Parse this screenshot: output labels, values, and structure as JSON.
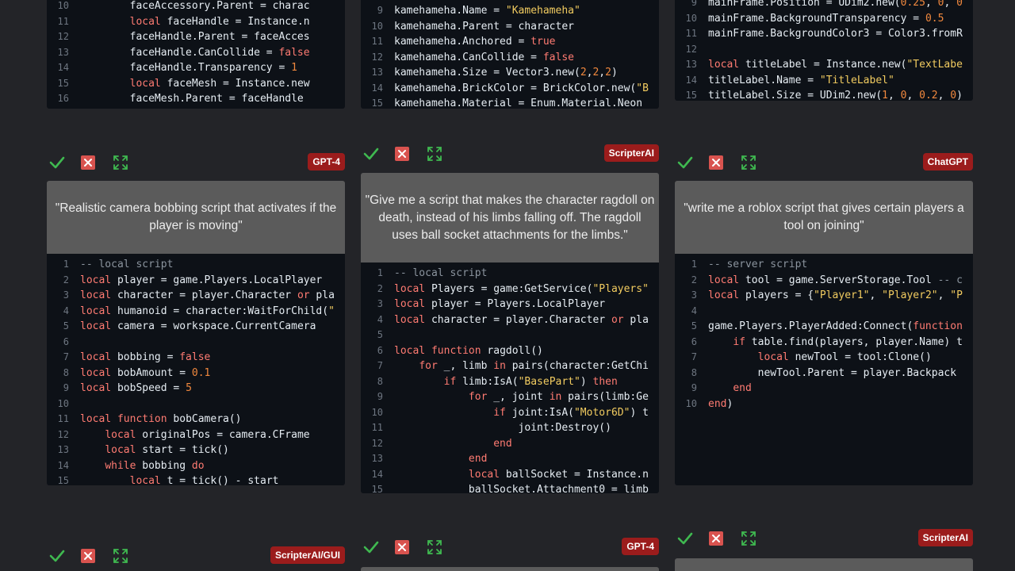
{
  "colors": {
    "background": "#232428",
    "check": "#3fb950",
    "reject": "#d9534f",
    "expand": "#3fb950",
    "badge": "#9b1c1c",
    "prompt_bg": "#5b5b5b",
    "code_bg": "#0d1117"
  },
  "icons": [
    "check-icon",
    "reject-x-icon",
    "expand-icon"
  ],
  "top_row": [
    {
      "lines": [
        {
          "n": "10",
          "t": "        faceAccessory.Parent = charac"
        },
        {
          "n": "11",
          "t": "        local faceHandle = Instance.n"
        },
        {
          "n": "12",
          "t": "        faceHandle.Parent = faceAcces"
        },
        {
          "n": "13",
          "t": "        faceHandle.CanCollide = false"
        },
        {
          "n": "14",
          "t": "        faceHandle.Transparency = 1"
        },
        {
          "n": "15",
          "t": "        local faceMesh = Instance.new"
        },
        {
          "n": "16",
          "t": "        faceMesh.Parent = faceHandle"
        }
      ]
    },
    {
      "lines": [
        {
          "n": "9",
          "t": "kamehameha.Name = \"Kamehameha\""
        },
        {
          "n": "10",
          "t": "kamehameha.Parent = character"
        },
        {
          "n": "11",
          "t": "kamehameha.Anchored = true"
        },
        {
          "n": "12",
          "t": "kamehameha.CanCollide = false"
        },
        {
          "n": "13",
          "t": "kamehameha.Size = Vector3.new(2,2,2)"
        },
        {
          "n": "14",
          "t": "kamehameha.BrickColor = BrickColor.new(\"B"
        },
        {
          "n": "15",
          "t": "kamehameha.Material = Enum.Material.Neon"
        }
      ]
    },
    {
      "lines": [
        {
          "n": "9",
          "t": "mainFrame.Position = UDim2.new(0.25, 0, 0"
        },
        {
          "n": "10",
          "t": "mainFrame.BackgroundTransparency = 0.5"
        },
        {
          "n": "11",
          "t": "mainFrame.BackgroundColor3 = Color3.fromR"
        },
        {
          "n": "12",
          "t": ""
        },
        {
          "n": "13",
          "t": "local titleLabel = Instance.new(\"TextLabe"
        },
        {
          "n": "14",
          "t": "titleLabel.Name = \"TitleLabel\""
        },
        {
          "n": "15",
          "t": "titleLabel.Size = UDim2.new(1, 0, 0.2, 0)"
        }
      ]
    }
  ],
  "middle_row": [
    {
      "badge": "GPT-4",
      "prompt": "\"Realistic camera bobbing script that activates if the player is moving\"",
      "lines": [
        {
          "n": "1",
          "t": "-- local script"
        },
        {
          "n": "2",
          "t": "local player = game.Players.LocalPlayer"
        },
        {
          "n": "3",
          "t": "local character = player.Character or pla"
        },
        {
          "n": "4",
          "t": "local humanoid = character:WaitForChild(\""
        },
        {
          "n": "5",
          "t": "local camera = workspace.CurrentCamera"
        },
        {
          "n": "6",
          "t": ""
        },
        {
          "n": "7",
          "t": "local bobbing = false"
        },
        {
          "n": "8",
          "t": "local bobAmount = 0.1"
        },
        {
          "n": "9",
          "t": "local bobSpeed = 5"
        },
        {
          "n": "10",
          "t": ""
        },
        {
          "n": "11",
          "t": "local function bobCamera()"
        },
        {
          "n": "12",
          "t": "    local originalPos = camera.CFrame"
        },
        {
          "n": "13",
          "t": "    local start = tick()"
        },
        {
          "n": "14",
          "t": "    while bobbing do"
        },
        {
          "n": "15",
          "t": "        local t = tick() - start"
        }
      ]
    },
    {
      "badge": "ScripterAI",
      "prompt": "\"Give me a script that makes the character ragdoll on death, instead of his limbs falling off. The ragdoll uses ball socket attachments for the limbs.\"",
      "lines": [
        {
          "n": "1",
          "t": "-- local script"
        },
        {
          "n": "2",
          "t": "local Players = game:GetService(\"Players\""
        },
        {
          "n": "3",
          "t": "local player = Players.LocalPlayer"
        },
        {
          "n": "4",
          "t": "local character = player.Character or pla"
        },
        {
          "n": "5",
          "t": ""
        },
        {
          "n": "6",
          "t": "local function ragdoll()"
        },
        {
          "n": "7",
          "t": "    for _, limb in pairs(character:GetChi"
        },
        {
          "n": "8",
          "t": "        if limb:IsA(\"BasePart\") then"
        },
        {
          "n": "9",
          "t": "            for _, joint in pairs(limb:Ge"
        },
        {
          "n": "10",
          "t": "                if joint:IsA(\"Motor6D\") t"
        },
        {
          "n": "11",
          "t": "                    joint:Destroy()"
        },
        {
          "n": "12",
          "t": "                end"
        },
        {
          "n": "13",
          "t": "            end"
        },
        {
          "n": "14",
          "t": "            local ballSocket = Instance.n"
        },
        {
          "n": "15",
          "t": "            ballSocket.Attachment0 = limb"
        }
      ]
    },
    {
      "badge": "ChatGPT",
      "prompt": "\"write me a roblox script that gives certain players a tool on joining\"",
      "lines": [
        {
          "n": "1",
          "t": "-- server script"
        },
        {
          "n": "2",
          "t": "local tool = game.ServerStorage.Tool -- c"
        },
        {
          "n": "3",
          "t": "local players = {\"Player1\", \"Player2\", \"P"
        },
        {
          "n": "4",
          "t": ""
        },
        {
          "n": "5",
          "t": "game.Players.PlayerAdded:Connect(function"
        },
        {
          "n": "6",
          "t": "    if table.find(players, player.Name) t"
        },
        {
          "n": "7",
          "t": "        local newTool = tool:Clone()"
        },
        {
          "n": "8",
          "t": "        newTool.Parent = player.Backpack"
        },
        {
          "n": "9",
          "t": "    end"
        },
        {
          "n": "10",
          "t": "end)"
        }
      ]
    }
  ],
  "bottom_row": [
    {
      "badge": "ScripterAI/GUI"
    },
    {
      "badge": "GPT-4"
    },
    {
      "badge": "ScripterAI"
    }
  ]
}
